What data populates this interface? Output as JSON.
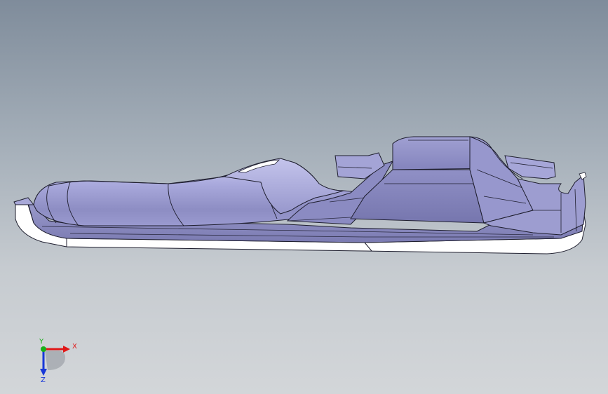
{
  "viewport": {
    "background_top": "#7f8c9b",
    "background_bottom": "#d3d6d9"
  },
  "model": {
    "face_color": "#b8b8e6",
    "face_dark": "#8a8ac0",
    "edge_color": "#1e1e2e",
    "rim_color": "#ffffff"
  },
  "triad": {
    "x_label": "X",
    "y_label": "Y",
    "z_label": "Z",
    "x_color": "#e01818",
    "y_color": "#18b018",
    "z_color": "#1838d8"
  }
}
